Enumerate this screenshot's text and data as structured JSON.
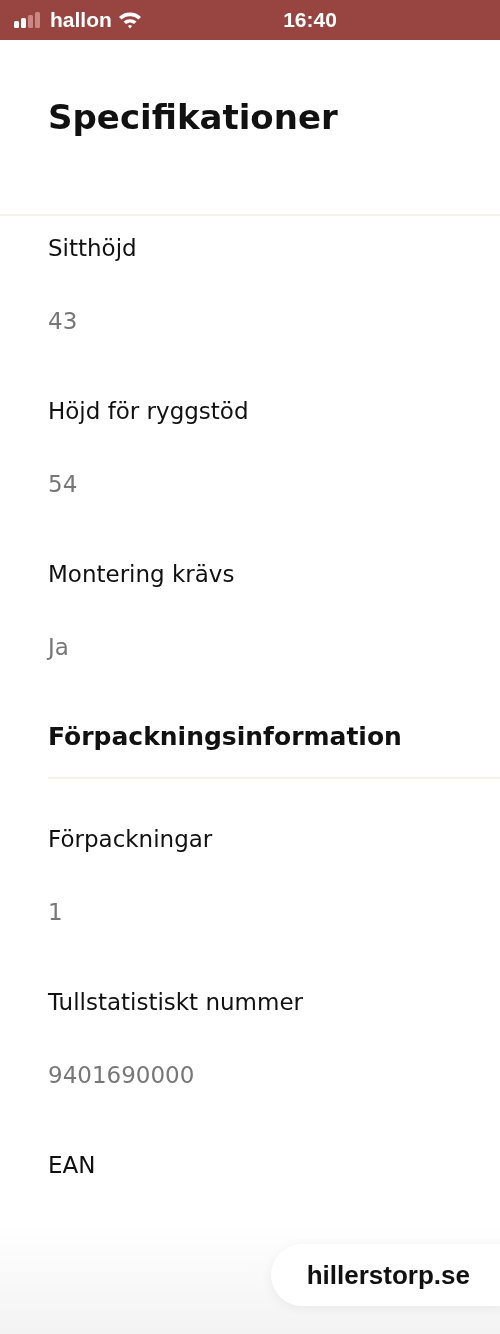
{
  "status_bar": {
    "carrier": "hallon",
    "time": "16:40"
  },
  "title": "Specifikationer",
  "specs": [
    {
      "label": "Sitthöjd",
      "value": "43"
    },
    {
      "label": "Höjd för ryggstöd",
      "value": "54"
    },
    {
      "label": "Montering krävs",
      "value": "Ja"
    }
  ],
  "packaging": {
    "title": "Förpackningsinformation",
    "items": [
      {
        "label": "Förpackningar",
        "value": "1"
      },
      {
        "label": "Tullstatistiskt nummer",
        "value": "9401690000"
      },
      {
        "label": "EAN"
      }
    ]
  },
  "site_pill": "hillerstorp.se"
}
